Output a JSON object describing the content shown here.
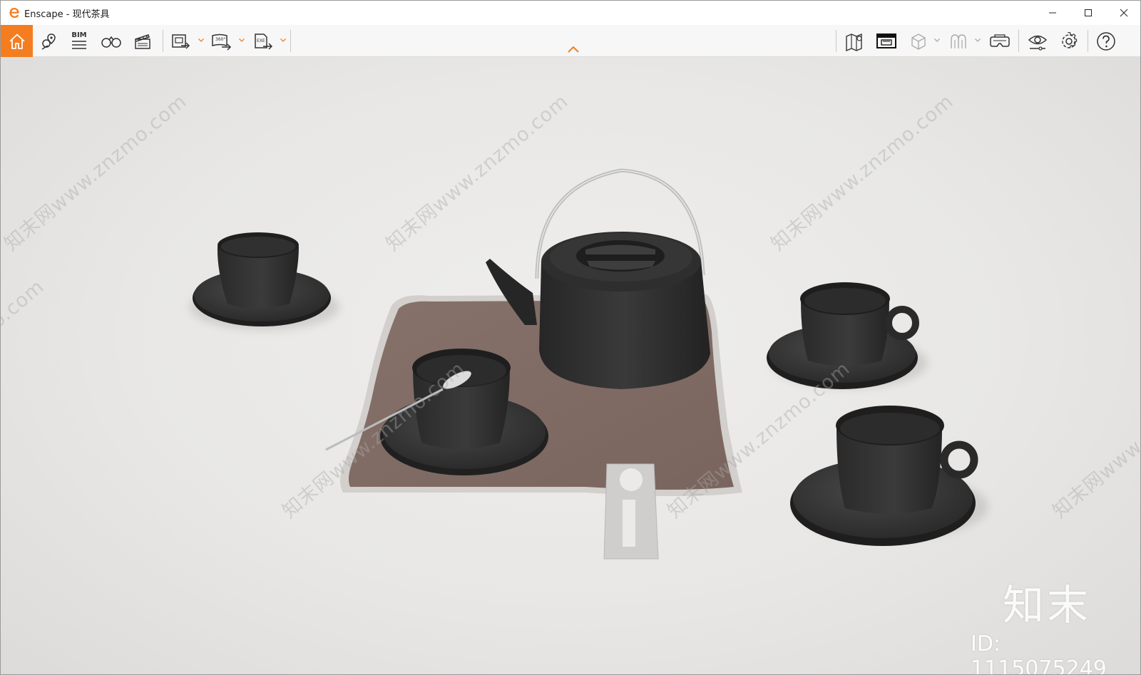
{
  "window": {
    "title": "Enscape - 现代茶具",
    "controls": [
      "minimize-icon",
      "maximize-icon",
      "close-icon"
    ]
  },
  "toolbar": {
    "accent_color": "#f47d20",
    "left_tools": [
      {
        "icon": "home-icon",
        "label": ""
      },
      {
        "icon": "map-pin-icon",
        "label": ""
      },
      {
        "icon": "bim-icon",
        "label": "BIM"
      },
      {
        "icon": "binoculars-icon",
        "label": ""
      },
      {
        "icon": "clapperboard-icon",
        "label": ""
      },
      {
        "icon": "export-image-icon",
        "label": ""
      },
      {
        "icon": "export-panorama-icon",
        "label": "360°"
      },
      {
        "icon": "export-exe-icon",
        "label": "EXE"
      }
    ],
    "right_tools": [
      {
        "icon": "map-icon"
      },
      {
        "icon": "screen-capture-icon"
      },
      {
        "icon": "cube-icon"
      },
      {
        "icon": "walk-figure-icon"
      },
      {
        "icon": "vr-headset-icon"
      },
      {
        "icon": "eye-icon"
      },
      {
        "icon": "gear-icon"
      },
      {
        "icon": "help-icon"
      }
    ]
  },
  "viewport": {
    "watermark_text": "知末网www.znzmo.com",
    "brand": "知末",
    "id_label": "ID: 1115075249"
  }
}
